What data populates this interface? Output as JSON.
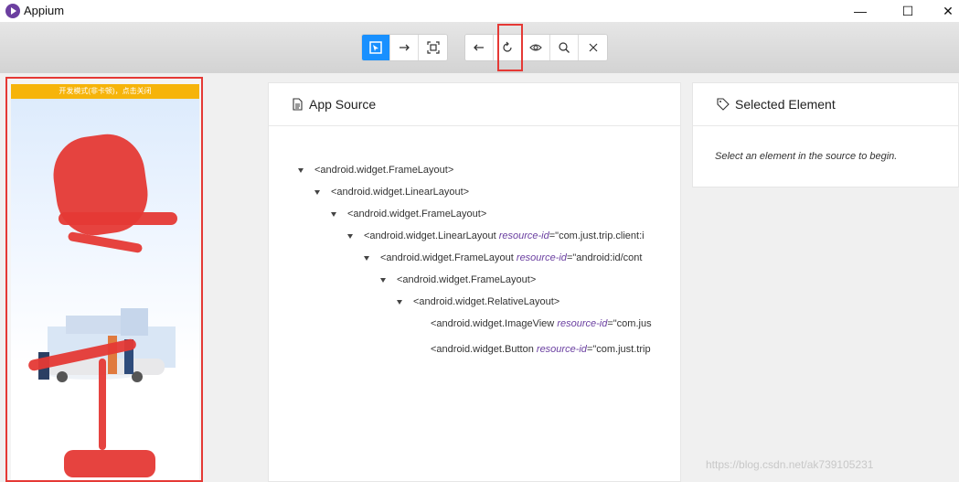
{
  "window": {
    "title": "Appium",
    "controls": {
      "minimize": "—",
      "maximize": "☐",
      "close": "✕"
    }
  },
  "toolbar": {
    "mode_buttons": [
      {
        "name": "select-elements",
        "icon": "select-icon",
        "active": true
      },
      {
        "name": "swipe",
        "icon": "arrow-right-icon",
        "active": false
      },
      {
        "name": "tap-coordinates",
        "icon": "screen-capture-icon",
        "active": false
      }
    ],
    "action_buttons": [
      {
        "name": "back",
        "icon": "arrow-left-icon"
      },
      {
        "name": "refresh",
        "icon": "refresh-icon"
      },
      {
        "name": "toggle-visibility",
        "icon": "eye-icon"
      },
      {
        "name": "search",
        "icon": "search-icon"
      },
      {
        "name": "quit",
        "icon": "close-icon"
      }
    ]
  },
  "device": {
    "banner_text": "开发模式(非卡顿)，点击关闭"
  },
  "source_panel": {
    "title": "App Source",
    "icon": "file-icon",
    "nodes": [
      {
        "tag": "<android.widget.FrameLayout>",
        "attr": "",
        "value": "",
        "expandable": true
      },
      {
        "tag": "<android.widget.LinearLayout>",
        "attr": "",
        "value": "",
        "expandable": true
      },
      {
        "tag": "<android.widget.FrameLayout>",
        "attr": "",
        "value": "",
        "expandable": true
      },
      {
        "tag": "<android.widget.LinearLayout",
        "attr": "resource-id",
        "value": "=\"com.just.trip.client:i",
        "expandable": true
      },
      {
        "tag": "<android.widget.FrameLayout",
        "attr": "resource-id",
        "value": "=\"android:id/cont",
        "expandable": true
      },
      {
        "tag": "<android.widget.FrameLayout>",
        "attr": "",
        "value": "",
        "expandable": true
      },
      {
        "tag": "<android.widget.RelativeLayout>",
        "attr": "",
        "value": "",
        "expandable": true
      },
      {
        "tag": "<android.widget.ImageView",
        "attr": "resource-id",
        "value": "=\"com.jus",
        "expandable": false
      },
      {
        "tag": "<android.widget.Button",
        "attr": "resource-id",
        "value": "=\"com.just.trip",
        "expandable": false
      }
    ]
  },
  "selected_panel": {
    "title": "Selected Element",
    "icon": "tag-icon",
    "hint": "Select an element in the source to begin."
  },
  "watermark": "https://blog.csdn.net/ak739105231",
  "colors": {
    "accent": "#1890ff",
    "highlight": "#e53935",
    "banner": "#f6b40a"
  }
}
